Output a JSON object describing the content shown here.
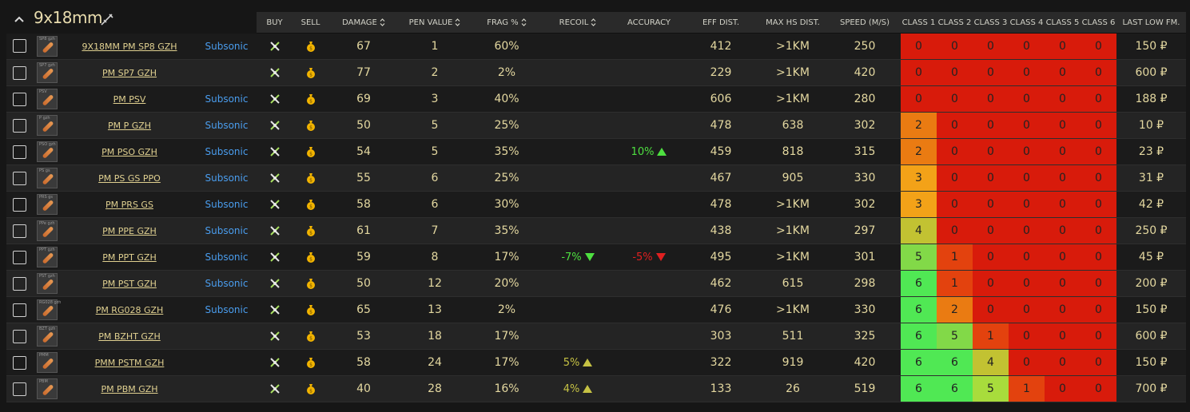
{
  "caliber": {
    "title": "9x18mm",
    "collapse_icon": "chevron-up-icon",
    "weapon_icon": "pistol-icon"
  },
  "columns": {
    "buy": "BUY",
    "sell": "SELL",
    "damage": "DAMAGE",
    "pen_value": "PEN VALUE",
    "frag": "FRAG %",
    "recoil": "RECOIL",
    "accuracy": "ACCURACY",
    "eff_dist": "EFF DIST.",
    "max_hs_dist": "MAX HS DIST.",
    "speed": "SPEED (M/S)",
    "class1": "CLASS 1",
    "class2": "CLASS 2",
    "class3": "CLASS 3",
    "class4": "CLASS 4",
    "class5": "CLASS 5",
    "class6": "CLASS 6",
    "last_low_fm": "LAST LOW FM."
  },
  "colors": {
    "accent_text": "#e0d090",
    "subsonic": "#4a9dee",
    "class_red": "#d81b0b",
    "class_green": "#50e854"
  },
  "rows": [
    {
      "thumb": "SP8 gzh",
      "name": "9X18MM PM SP8 GZH",
      "tag": "Subsonic",
      "damage": "67",
      "pen": "1",
      "frag": "60%",
      "recoil": "",
      "recoil_dir": "",
      "accuracy": "",
      "accuracy_dir": "",
      "eff": "412",
      "hs": ">1KM",
      "speed": "250",
      "classes": [
        "0",
        "0",
        "0",
        "0",
        "0",
        "0"
      ],
      "class_colors": [
        "red",
        "red",
        "red",
        "red",
        "red",
        "red"
      ],
      "price": "150 ₽"
    },
    {
      "thumb": "SP7 gzh",
      "name": "PM SP7 GZH",
      "tag": "",
      "damage": "77",
      "pen": "2",
      "frag": "2%",
      "recoil": "",
      "recoil_dir": "",
      "accuracy": "",
      "accuracy_dir": "",
      "eff": "229",
      "hs": ">1KM",
      "speed": "420",
      "classes": [
        "0",
        "0",
        "0",
        "0",
        "0",
        "0"
      ],
      "class_colors": [
        "red",
        "red",
        "red",
        "red",
        "red",
        "red"
      ],
      "price": "600 ₽"
    },
    {
      "thumb": "PSV",
      "name": "PM PSV",
      "tag": "Subsonic",
      "damage": "69",
      "pen": "3",
      "frag": "40%",
      "recoil": "",
      "recoil_dir": "",
      "accuracy": "",
      "accuracy_dir": "",
      "eff": "606",
      "hs": ">1KM",
      "speed": "280",
      "classes": [
        "0",
        "0",
        "0",
        "0",
        "0",
        "0"
      ],
      "class_colors": [
        "red",
        "red",
        "red",
        "red",
        "red",
        "red"
      ],
      "price": "188 ₽"
    },
    {
      "thumb": "P gzh",
      "name": "PM P GZH",
      "tag": "Subsonic",
      "damage": "50",
      "pen": "5",
      "frag": "25%",
      "recoil": "",
      "recoil_dir": "",
      "accuracy": "",
      "accuracy_dir": "",
      "eff": "478",
      "hs": "638",
      "speed": "302",
      "classes": [
        "2",
        "0",
        "0",
        "0",
        "0",
        "0"
      ],
      "class_colors": [
        "orange",
        "red",
        "red",
        "red",
        "red",
        "red"
      ],
      "price": "10 ₽"
    },
    {
      "thumb": "PSO gzh",
      "name": "PM PSO GZH",
      "tag": "Subsonic",
      "damage": "54",
      "pen": "5",
      "frag": "35%",
      "recoil": "",
      "recoil_dir": "",
      "accuracy": "10%",
      "accuracy_dir": "up-green",
      "eff": "459",
      "hs": "818",
      "speed": "315",
      "classes": [
        "2",
        "0",
        "0",
        "0",
        "0",
        "0"
      ],
      "class_colors": [
        "orange",
        "red",
        "red",
        "red",
        "red",
        "red"
      ],
      "price": "23 ₽"
    },
    {
      "thumb": "PS gs",
      "name": "PM PS GS PPO",
      "tag": "Subsonic",
      "damage": "55",
      "pen": "6",
      "frag": "25%",
      "recoil": "",
      "recoil_dir": "",
      "accuracy": "",
      "accuracy_dir": "",
      "eff": "467",
      "hs": "905",
      "speed": "330",
      "classes": [
        "3",
        "0",
        "0",
        "0",
        "0",
        "0"
      ],
      "class_colors": [
        "amber",
        "red",
        "red",
        "red",
        "red",
        "red"
      ],
      "price": "31 ₽"
    },
    {
      "thumb": "PRS gs",
      "name": "PM PRS GS",
      "tag": "Subsonic",
      "damage": "58",
      "pen": "6",
      "frag": "30%",
      "recoil": "",
      "recoil_dir": "",
      "accuracy": "",
      "accuracy_dir": "",
      "eff": "478",
      "hs": ">1KM",
      "speed": "302",
      "classes": [
        "3",
        "0",
        "0",
        "0",
        "0",
        "0"
      ],
      "class_colors": [
        "amber",
        "red",
        "red",
        "red",
        "red",
        "red"
      ],
      "price": "42 ₽"
    },
    {
      "thumb": "PPe gzh",
      "name": "PM PPE GZH",
      "tag": "Subsonic",
      "damage": "61",
      "pen": "7",
      "frag": "35%",
      "recoil": "",
      "recoil_dir": "",
      "accuracy": "",
      "accuracy_dir": "",
      "eff": "438",
      "hs": ">1KM",
      "speed": "297",
      "classes": [
        "4",
        "0",
        "0",
        "0",
        "0",
        "0"
      ],
      "class_colors": [
        "olive",
        "red",
        "red",
        "red",
        "red",
        "red"
      ],
      "price": "250 ₽"
    },
    {
      "thumb": "PPT gzh",
      "name": "PM PPT GZH",
      "tag": "Subsonic",
      "damage": "59",
      "pen": "8",
      "frag": "17%",
      "recoil": "-7%",
      "recoil_dir": "down-green",
      "accuracy": "-5%",
      "accuracy_dir": "down-red",
      "eff": "495",
      "hs": ">1KM",
      "speed": "301",
      "classes": [
        "5",
        "1",
        "0",
        "0",
        "0",
        "0"
      ],
      "class_colors": [
        "lightgreen",
        "deeporange",
        "red",
        "red",
        "red",
        "red"
      ],
      "price": "45 ₽"
    },
    {
      "thumb": "PST gzh",
      "name": "PM PST GZH",
      "tag": "Subsonic",
      "damage": "50",
      "pen": "12",
      "frag": "20%",
      "recoil": "",
      "recoil_dir": "",
      "accuracy": "",
      "accuracy_dir": "",
      "eff": "462",
      "hs": "615",
      "speed": "298",
      "classes": [
        "6",
        "1",
        "0",
        "0",
        "0",
        "0"
      ],
      "class_colors": [
        "green",
        "deeporange",
        "red",
        "red",
        "red",
        "red"
      ],
      "price": "200 ₽"
    },
    {
      "thumb": "RG028 gzh",
      "name": "PM RG028 GZH",
      "tag": "Subsonic",
      "damage": "65",
      "pen": "13",
      "frag": "2%",
      "recoil": "",
      "recoil_dir": "",
      "accuracy": "",
      "accuracy_dir": "",
      "eff": "476",
      "hs": ">1KM",
      "speed": "330",
      "classes": [
        "6",
        "2",
        "0",
        "0",
        "0",
        "0"
      ],
      "class_colors": [
        "green",
        "orange",
        "red",
        "red",
        "red",
        "red"
      ],
      "price": "150 ₽"
    },
    {
      "thumb": "BZT gzh",
      "name": "PM BZHT GZH",
      "tag": "",
      "damage": "53",
      "pen": "18",
      "frag": "17%",
      "recoil": "",
      "recoil_dir": "",
      "accuracy": "",
      "accuracy_dir": "",
      "eff": "303",
      "hs": "511",
      "speed": "325",
      "classes": [
        "6",
        "5",
        "1",
        "0",
        "0",
        "0"
      ],
      "class_colors": [
        "green",
        "lightgreen",
        "deeporange",
        "red",
        "red",
        "red"
      ],
      "price": "600 ₽"
    },
    {
      "thumb": "PMM",
      "name": "PMM PSTM GZH",
      "tag": "",
      "damage": "58",
      "pen": "24",
      "frag": "17%",
      "recoil": "5%",
      "recoil_dir": "up-yellow",
      "accuracy": "",
      "accuracy_dir": "",
      "eff": "322",
      "hs": "919",
      "speed": "420",
      "classes": [
        "6",
        "6",
        "4",
        "0",
        "0",
        "0"
      ],
      "class_colors": [
        "green",
        "green",
        "olive",
        "red",
        "red",
        "red"
      ],
      "price": "150 ₽"
    },
    {
      "thumb": "PBM",
      "name": "PM PBM GZH",
      "tag": "",
      "damage": "40",
      "pen": "28",
      "frag": "16%",
      "recoil": "4%",
      "recoil_dir": "up-yellow",
      "accuracy": "",
      "accuracy_dir": "",
      "eff": "133",
      "hs": "26",
      "speed": "519",
      "classes": [
        "6",
        "6",
        "5",
        "1",
        "0",
        "0"
      ],
      "class_colors": [
        "green",
        "green",
        "lime",
        "deeporange",
        "red",
        "red"
      ],
      "price": "700 ₽"
    }
  ]
}
